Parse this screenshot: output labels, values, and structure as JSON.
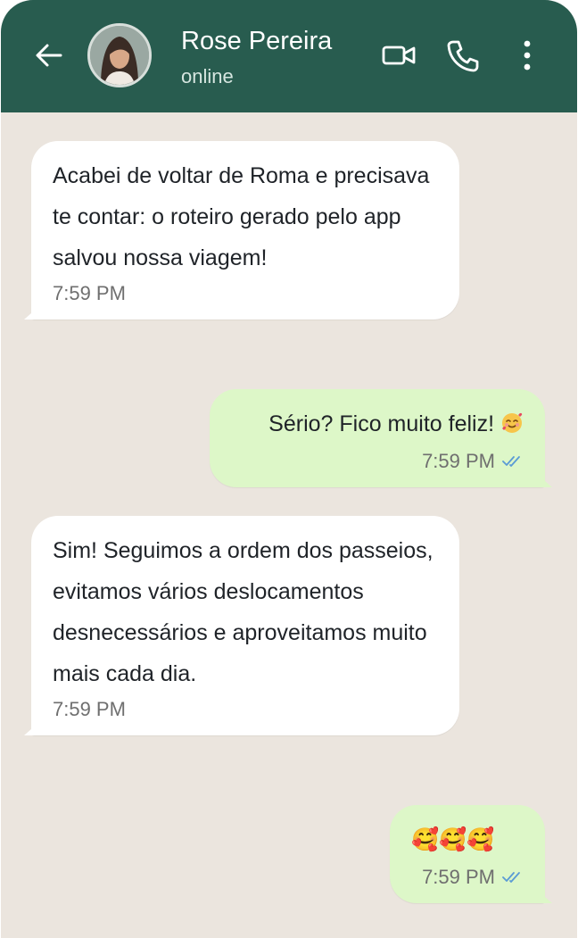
{
  "contact": {
    "name": "Rose Pereira",
    "status": "online"
  },
  "colors": {
    "header": "#285c4f",
    "chat_background": "#ebe5de",
    "incoming_bubble": "#ffffff",
    "outgoing_bubble": "#ddf7c8",
    "read_ticks": "#5a9bd5"
  },
  "icons": {
    "back": "arrow-left-icon",
    "video": "video-camera-icon",
    "call": "phone-icon",
    "menu": "vertical-dots-icon",
    "read_receipt": "double-check-icon",
    "emoji": "smiling-face-with-hearts-emoji"
  },
  "messages": [
    {
      "direction": "incoming",
      "text": "Acabei de voltar de Roma e precisava te contar: o roteiro gerado pelo app salvou nossa viagem!",
      "time": "7:59 PM"
    },
    {
      "direction": "outgoing",
      "text": "Sério? Fico muito feliz!",
      "emoji": "🥰",
      "time": "7:59 PM",
      "read": true
    },
    {
      "direction": "incoming",
      "text": "Sim! Seguimos a ordem dos passeios, evitamos vários deslocamentos desnecessários e aproveitamos muito mais cada dia.",
      "time": "7:59 PM"
    },
    {
      "direction": "outgoing",
      "text": "🥰🥰🥰",
      "time": "7:59 PM",
      "read": true
    }
  ]
}
